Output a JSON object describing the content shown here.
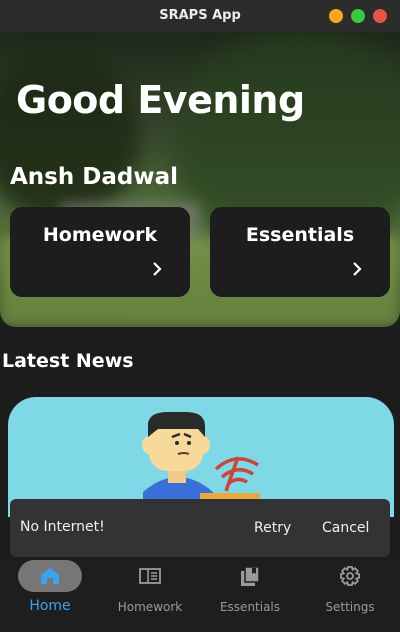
{
  "window": {
    "title": "SRAPS App"
  },
  "hero": {
    "greeting": "Good Evening",
    "user_name": "Ansh Dadwal"
  },
  "cards": [
    {
      "label": "Homework",
      "icon": "chevron-right-icon"
    },
    {
      "label": "Essentials",
      "icon": "chevron-right-icon"
    }
  ],
  "news": {
    "section_title": "Latest News",
    "illustration": "person-no-wifi-illustration"
  },
  "snackbar": {
    "message": "No Internet!",
    "retry_label": "Retry",
    "cancel_label": "Cancel"
  },
  "nav": {
    "active": "Home",
    "accent_color": "#3aa4ef",
    "items": [
      {
        "label": "Home",
        "icon": "home-icon"
      },
      {
        "label": "Homework",
        "icon": "book-icon"
      },
      {
        "label": "Essentials",
        "icon": "library-icon"
      },
      {
        "label": "Settings",
        "icon": "gear-icon"
      }
    ]
  }
}
